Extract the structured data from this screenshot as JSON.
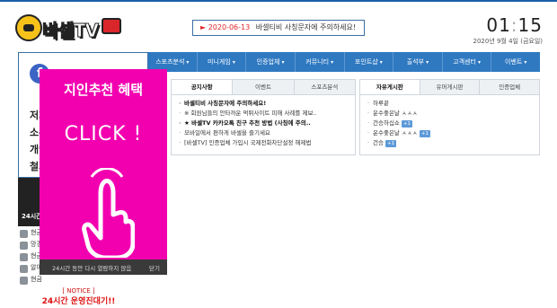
{
  "brand": {
    "logo_text": "바셀TV"
  },
  "ticker": {
    "date": "2020-06-13",
    "text": "바셀티비 사칭문자에 주의하세요!"
  },
  "clock": {
    "hour": "01",
    "minute": "15",
    "date": "2020년 9월 4일 (금요일)"
  },
  "left": {
    "login_lines": [
      "저희",
      "소유",
      "개인",
      "철거"
    ],
    "dark_label": "24시간",
    "rows": [
      "현금",
      "망경",
      "현금",
      "알아두 X",
      "현금"
    ],
    "notice_title": "[ NOTICE ]",
    "notice_text": "24시간 운영진대기!!"
  },
  "popup": {
    "headline": "지인추천 혜택",
    "click": "CLICK !",
    "footer_msg": "24시간 동안 다시 열람하지 않음",
    "close": "닫기"
  },
  "nav": [
    "스포츠분석",
    "미니게임",
    "인증업체",
    "커뮤니티",
    "포인트샵",
    "출석부",
    "고객센터",
    "이벤트"
  ],
  "board1": {
    "tabs": [
      "공지사항",
      "이벤트",
      "스포츠분석"
    ],
    "posts": [
      {
        "text": "바셀티비 사칭문자에 주의하세요!",
        "hot": true
      },
      {
        "text": "※ 회원님들의 안타까운 먹튀사이트 피해 사례를 제보..",
        "hot": false
      },
      {
        "text": "★ 바셀TV 카카오톡 친구 추천 방법 (사칭에 주의..",
        "hot": true
      },
      {
        "text": "모바일에서 편하게 바셀을 즐기세요",
        "hot": false
      },
      {
        "text": "[바셀TV] 인증업체 가입시 국제전화차단설정 해제법",
        "hot": false
      }
    ]
  },
  "board2": {
    "tabs": [
      "자유게시판",
      "유머게시판",
      "인증업체"
    ],
    "posts": [
      {
        "text": "하루끝",
        "badge": ""
      },
      {
        "text": "운수좋은날 ㅅㅅㅅ",
        "badge": ""
      },
      {
        "text": "건승하십쇼",
        "badge": "+1"
      },
      {
        "text": "운수좋은날 ㅅㅅㅅ",
        "badge": "+1"
      },
      {
        "text": "건승",
        "badge": "+1"
      }
    ]
  },
  "colors": {
    "nav_bg": "#2f79c1",
    "popup_bg": "#f200b0",
    "accent": "#e0262b"
  }
}
